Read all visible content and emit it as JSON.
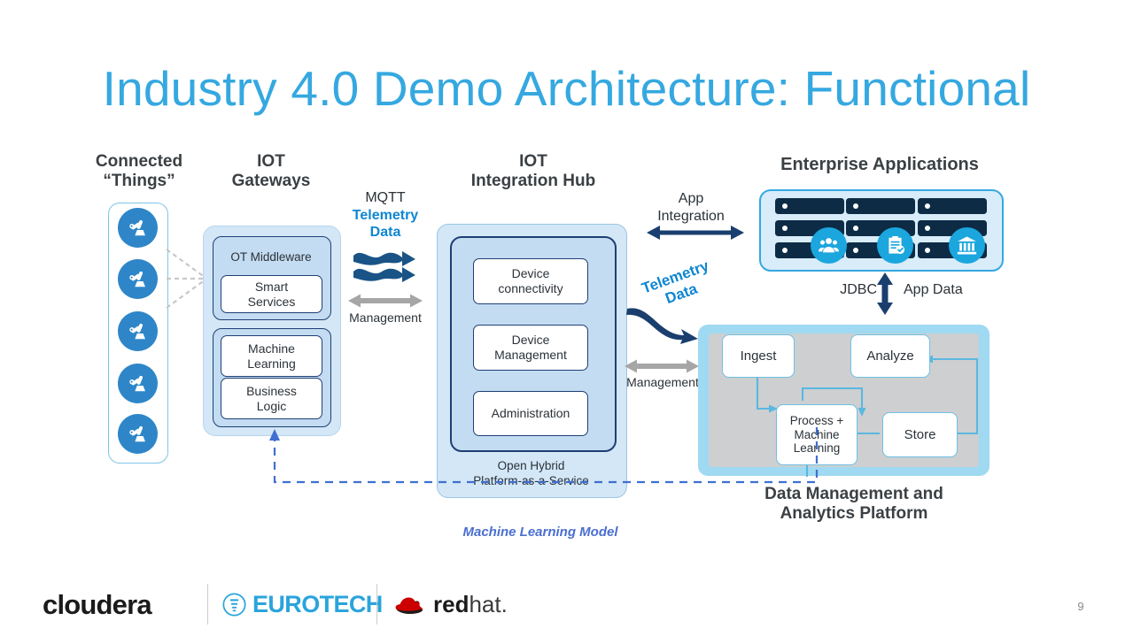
{
  "slide": {
    "title": "Industry 4.0 Demo Architecture: Functional",
    "page_number": "9",
    "title_color": "#35a8e0"
  },
  "headings": {
    "connected_things_line1": "Connected",
    "connected_things_line2": "“Things”",
    "iot_gateways_line1": "IOT",
    "iot_gateways_line2": "Gateways",
    "iot_hub_line1": "IOT",
    "iot_hub_line2": "Integration Hub",
    "enterprise_apps": "Enterprise Applications"
  },
  "connected_things": {
    "icon_name": "robot-arm-icon",
    "count": 5,
    "icon_color": "#2e86c8"
  },
  "iot_gateways": {
    "ot_middleware_label": "OT Middleware",
    "smart_services_line1": "Smart",
    "smart_services_line2": "Services",
    "machine_learning_line1": "Machine",
    "machine_learning_line2": "Learning",
    "business_logic_line1": "Business",
    "business_logic_line2": "Logic"
  },
  "mqtt_link": {
    "protocol": "MQTT",
    "telemetry_line1": "Telemetry",
    "telemetry_line2": "Data",
    "management_label": "Management",
    "telemetry_color": "#0f86d1",
    "arrow_color": "#1a5487"
  },
  "iot_hub": {
    "device_connectivity_line1": "Device",
    "device_connectivity_line2": "connectivity",
    "device_management_line1": "Device",
    "device_management_line2": "Management",
    "administration": "Administration",
    "caption_line1": "Open Hybrid",
    "caption_line2": "Platform-as-a-Service"
  },
  "hub_to_platform": {
    "app_integration_line1": "App",
    "app_integration_line2": "Integration",
    "telemetry_line1": "Telemetry",
    "telemetry_line2": "Data",
    "management_label": "Management"
  },
  "enterprise_apps": {
    "racks": 3,
    "icons": [
      "users-group-icon",
      "clipboard-check-icon",
      "bank-building-icon"
    ],
    "rack_color": "#0d2b45",
    "icon_badge_color": "#1ba6de"
  },
  "db_link": {
    "jdbc_label": "JDBC",
    "app_data_label": "App Data"
  },
  "data_platform": {
    "ingest": "Ingest",
    "analyze": "Analyze",
    "process_line1": "Process +",
    "process_line2": "Machine",
    "process_line3": "Learning",
    "store": "Store",
    "caption_line1": "Data Management and",
    "caption_line2": "Analytics Platform",
    "flow": [
      {
        "from": "Ingest",
        "to": "Process + Machine Learning"
      },
      {
        "from": "Process + Machine Learning",
        "to": "Store"
      },
      {
        "from": "Store",
        "to": "Process + Machine Learning"
      },
      {
        "from": "Store",
        "to": "Analyze"
      }
    ]
  },
  "ml_feedback": {
    "label": "Machine Learning Model",
    "label_color": "#4a6fd0"
  },
  "footer": {
    "logo_cloudera": "cloudera",
    "logo_eurotech": "EUROTECH",
    "logo_redhat_bold": "red",
    "logo_redhat_light": "hat.",
    "eurotech_color": "#2aa4dc"
  }
}
